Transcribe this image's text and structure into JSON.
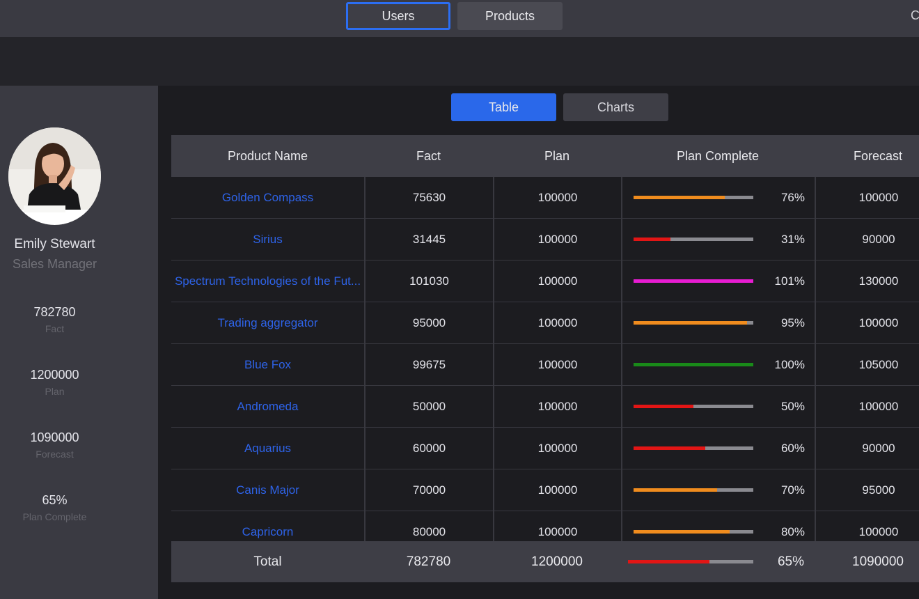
{
  "top_nav": {
    "users": "Users",
    "products": "Products",
    "cut_text": "Cl"
  },
  "profile": {
    "name": "Emily Stewart",
    "role": "Sales Manager"
  },
  "stats": [
    {
      "value": "782780",
      "label": "Fact"
    },
    {
      "value": "1200000",
      "label": "Plan"
    },
    {
      "value": "1090000",
      "label": "Forecast"
    },
    {
      "value": "65%",
      "label": "Plan Complete"
    }
  ],
  "view_tabs": {
    "table": "Table",
    "charts": "Charts"
  },
  "table": {
    "headers": [
      "Product Name",
      "Fact",
      "Plan",
      "Plan Complete",
      "Forecast"
    ],
    "rows": [
      {
        "name": "Golden Compass",
        "fact": "75630",
        "plan": "100000",
        "pct": "76%",
        "progress": 0.76,
        "color": "#f08c1e",
        "forecast": "100000"
      },
      {
        "name": "Sirius",
        "fact": "31445",
        "plan": "100000",
        "pct": "31%",
        "progress": 0.31,
        "color": "#e21515",
        "forecast": "90000"
      },
      {
        "name": "Spectrum Technologies of the Fut...",
        "fact": "101030",
        "plan": "100000",
        "pct": "101%",
        "progress": 1.0,
        "color": "#e81cd2",
        "forecast": "130000"
      },
      {
        "name": "Trading aggregator",
        "fact": "95000",
        "plan": "100000",
        "pct": "95%",
        "progress": 0.95,
        "color": "#f08c1e",
        "forecast": "100000"
      },
      {
        "name": "Blue Fox",
        "fact": "99675",
        "plan": "100000",
        "pct": "100%",
        "progress": 1.0,
        "color": "#198a19",
        "forecast": "105000"
      },
      {
        "name": "Andromeda",
        "fact": "50000",
        "plan": "100000",
        "pct": "50%",
        "progress": 0.5,
        "color": "#e21515",
        "forecast": "100000"
      },
      {
        "name": "Aquarius",
        "fact": "60000",
        "plan": "100000",
        "pct": "60%",
        "progress": 0.6,
        "color": "#e21515",
        "forecast": "90000"
      },
      {
        "name": "Canis Major",
        "fact": "70000",
        "plan": "100000",
        "pct": "70%",
        "progress": 0.7,
        "color": "#f08c1e",
        "forecast": "95000"
      },
      {
        "name": "Capricorn",
        "fact": "80000",
        "plan": "100000",
        "pct": "80%",
        "progress": 0.8,
        "color": "#f08c1e",
        "forecast": "100000"
      }
    ],
    "footer": {
      "label": "Total",
      "fact": "782780",
      "plan": "1200000",
      "pct": "65%",
      "progress": 0.65,
      "color": "#e21515",
      "forecast": "1090000"
    }
  }
}
